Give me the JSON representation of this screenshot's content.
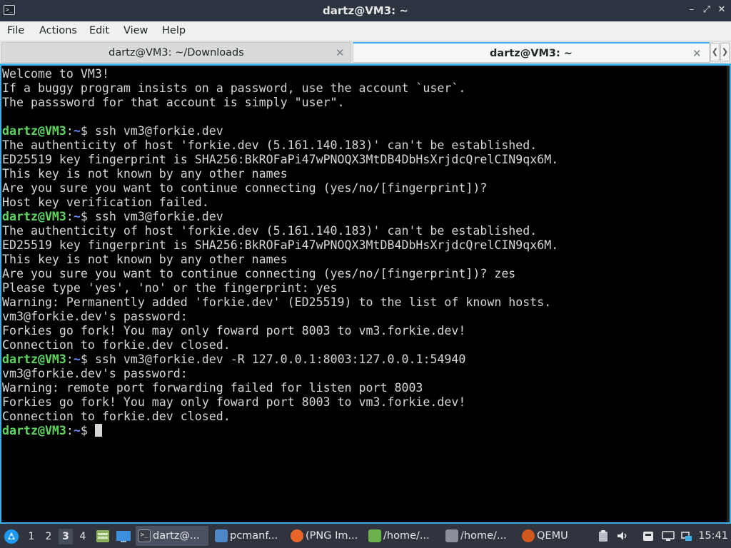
{
  "window": {
    "title": "dartz@VM3: ~",
    "minimize_glyph": "–",
    "maximize_glyph": "⤢",
    "close_glyph": "✕",
    "icon": "terminal-icon"
  },
  "menu": [
    "File",
    "Actions",
    "Edit",
    "View",
    "Help"
  ],
  "tabs": [
    {
      "label": "dartz@VM3: ~/Downloads",
      "active": false
    },
    {
      "label": "dartz@VM3: ~",
      "active": true
    }
  ],
  "prompt": {
    "user_host": "dartz@VM3",
    "colon": ":",
    "path": "~",
    "symbol": "$ "
  },
  "terminal_lines": [
    {
      "type": "text",
      "text": "Welcome to VM3!"
    },
    {
      "type": "text",
      "text": "If a buggy program insists on a password, use the account `user`."
    },
    {
      "type": "text",
      "text": "The passsword for that account is simply \"user\"."
    },
    {
      "type": "text",
      "text": ""
    },
    {
      "type": "prompt",
      "text": "ssh vm3@forkie.dev"
    },
    {
      "type": "text",
      "text": "The authenticity of host 'forkie.dev (5.161.140.183)' can't be established."
    },
    {
      "type": "text",
      "text": "ED25519 key fingerprint is SHA256:BkROFaPi47wPNOQX3MtDB4DbHsXrjdcQrelCIN9qx6M."
    },
    {
      "type": "text",
      "text": "This key is not known by any other names"
    },
    {
      "type": "text",
      "text": "Are you sure you want to continue connecting (yes/no/[fingerprint])?"
    },
    {
      "type": "text",
      "text": "Host key verification failed."
    },
    {
      "type": "prompt",
      "text": "ssh vm3@forkie.dev"
    },
    {
      "type": "text",
      "text": "The authenticity of host 'forkie.dev (5.161.140.183)' can't be established."
    },
    {
      "type": "text",
      "text": "ED25519 key fingerprint is SHA256:BkROFaPi47wPNOQX3MtDB4DbHsXrjdcQrelCIN9qx6M."
    },
    {
      "type": "text",
      "text": "This key is not known by any other names"
    },
    {
      "type": "text",
      "text": "Are you sure you want to continue connecting (yes/no/[fingerprint])? zes"
    },
    {
      "type": "text",
      "text": "Please type 'yes', 'no' or the fingerprint: yes"
    },
    {
      "type": "text",
      "text": "Warning: Permanently added 'forkie.dev' (ED25519) to the list of known hosts."
    },
    {
      "type": "text",
      "text": "vm3@forkie.dev's password:"
    },
    {
      "type": "text",
      "text": "Forkies go fork! You may only foward port 8003 to vm3.forkie.dev!"
    },
    {
      "type": "text",
      "text": "Connection to forkie.dev closed."
    },
    {
      "type": "prompt",
      "text": "ssh vm3@forkie.dev -R 127.0.0.1:8003:127.0.0.1:54940"
    },
    {
      "type": "text",
      "text": "vm3@forkie.dev's password:"
    },
    {
      "type": "text",
      "text": "Warning: remote port forwarding failed for listen port 8003"
    },
    {
      "type": "text",
      "text": "Forkies go fork! You may only foward port 8003 to vm3.forkie.dev!"
    },
    {
      "type": "text",
      "text": "Connection to forkie.dev closed."
    },
    {
      "type": "prompt",
      "text": "",
      "cursor": true
    }
  ],
  "taskbar": {
    "start_icon": "start-menu-icon",
    "workspaces": [
      "1",
      "2",
      "3",
      "4"
    ],
    "current_workspace": "3",
    "quicklaunch": [
      "file-manager-icon",
      "show-desktop-icon"
    ],
    "tasks": [
      {
        "label": "dartz@...",
        "icon": "terminal-icon",
        "color": "#3a3f47",
        "active": true
      },
      {
        "label": "pcmanf...",
        "icon": "folder-icon",
        "color": "#4f86c6",
        "active": false
      },
      {
        "label": "(PNG Im...",
        "icon": "firefox-icon",
        "color": "#e8652a",
        "active": false
      },
      {
        "label": "/home/...",
        "icon": "text-editor-icon",
        "color": "#6bb04a",
        "active": false
      },
      {
        "label": "/home/...",
        "icon": "document-icon",
        "color": "#8a8f99",
        "active": false
      },
      {
        "label": "QEMU",
        "icon": "qemu-icon",
        "color": "#d2571d",
        "active": false
      }
    ],
    "tray": [
      "clipboard-icon",
      "volume-icon",
      "removable-media-icon",
      "display-icon",
      "network-icon"
    ],
    "clock": "15:41"
  },
  "colors": {
    "accent": "#3daee9",
    "prompt_user": "#5fd75f",
    "prompt_path": "#6b8cff",
    "terminal_bg": "#000000",
    "taskbar_bg": "#2f343f"
  }
}
